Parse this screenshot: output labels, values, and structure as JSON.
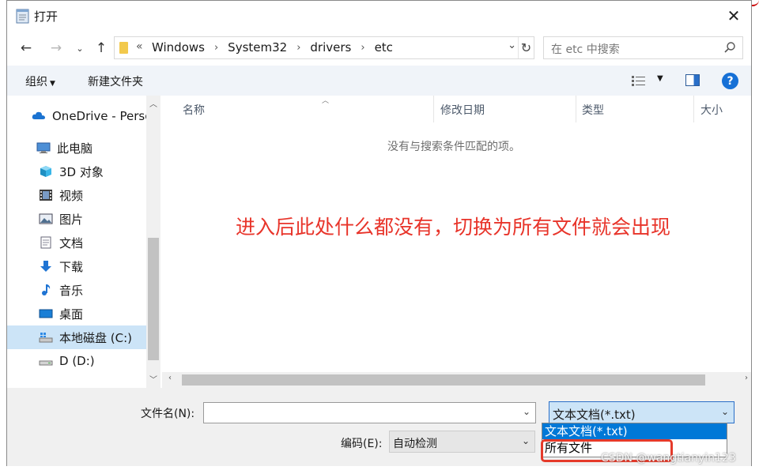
{
  "window": {
    "title": "打开"
  },
  "address": {
    "lead": "«",
    "crumbs": [
      "Windows",
      "System32",
      "drivers",
      "etc"
    ]
  },
  "search": {
    "placeholder": "在 etc 中搜索"
  },
  "toolbar": {
    "organize": "组织",
    "new_folder": "新建文件夹"
  },
  "nav": {
    "items": [
      {
        "label": "OneDrive - Perso",
        "icon": "cloud-icon"
      },
      {
        "label": "此电脑",
        "icon": "computer-icon"
      },
      {
        "label": "3D 对象",
        "icon": "cube-icon"
      },
      {
        "label": "视频",
        "icon": "film-icon"
      },
      {
        "label": "图片",
        "icon": "picture-icon"
      },
      {
        "label": "文档",
        "icon": "document-icon"
      },
      {
        "label": "下载",
        "icon": "download-icon"
      },
      {
        "label": "音乐",
        "icon": "music-icon"
      },
      {
        "label": "桌面",
        "icon": "desktop-icon"
      },
      {
        "label": "本地磁盘 (C:)",
        "icon": "drive-icon",
        "selected": true
      },
      {
        "label": "D (D:)",
        "icon": "drive-icon"
      }
    ]
  },
  "columns": {
    "name": "名称",
    "date": "修改日期",
    "type": "类型",
    "size": "大小"
  },
  "file_list": {
    "empty_message": "没有与搜索条件匹配的项。"
  },
  "annotation": "进入后此处什么都没有，切换为所有文件就会出现",
  "bottom": {
    "filename_label": "文件名(N):",
    "filename_value": "",
    "filetype_selected": "文本文档(*.txt)",
    "encoding_label": "编码(E):",
    "encoding_value": "自动检测"
  },
  "filetype_options": [
    "文本文档(*.txt)",
    "所有文件"
  ],
  "watermark": "CSDN @wangtianyin123",
  "colors": {
    "accent": "#0078d7",
    "annotation": "#e8342a",
    "selection": "#cce4f7"
  }
}
